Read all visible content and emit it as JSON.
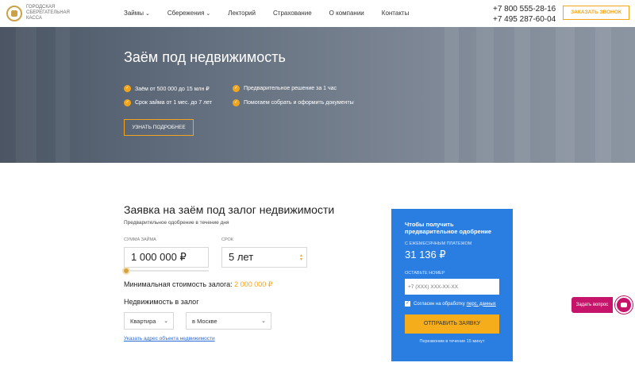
{
  "header": {
    "logo_text": "Городская сберегательная касса",
    "nav": [
      {
        "label": "Займы",
        "dropdown": true
      },
      {
        "label": "Сбережения",
        "dropdown": true
      },
      {
        "label": "Лекторий",
        "dropdown": false
      },
      {
        "label": "Страхование",
        "dropdown": false
      },
      {
        "label": "О компании",
        "dropdown": false
      },
      {
        "label": "Контакты",
        "dropdown": false
      }
    ],
    "phone1": "+7 800 555-28-16",
    "phone2": "+7 495 287-60-04",
    "call_button": "Заказать звонок"
  },
  "hero": {
    "title": "Заём под недвижимость",
    "features": [
      "Заём от 500 000 до 15 млн ₽",
      "Срок займа от 1 мес. до 7 лет",
      "Предварительное решение за 1 час",
      "Помогаем собрать и оформить документы"
    ],
    "more_button": "Узнать подробнее"
  },
  "form": {
    "title": "Заявка на заём под залог недвижимости",
    "subtitle": "Предварительное одобрение в течение дня",
    "amount_label": "Сумма займа",
    "amount_value": "1 000 000 ₽",
    "term_label": "Срок",
    "term_value": "5 лет",
    "min_cost_label": "Минимальная стоимость залога:",
    "min_cost_value": "2 000 000 ₽",
    "property_title": "Недвижимость в залог",
    "property_type": "Квартира",
    "property_location": "в Москве",
    "address_link": "Указать адрес объекта недвижимости"
  },
  "card": {
    "title": "Чтобы получить предварительное одобрение",
    "monthly_label": "С ежемесячным платежом",
    "monthly_value": "31 136 ₽",
    "phone_label": "Оставьте номер",
    "phone_placeholder": "+7 (XXX) XXX-XX-XX",
    "agree_text": "Согласен на обработку",
    "agree_link": "перс. данных",
    "agree_checked": true,
    "send_button": "Отправить заявку",
    "callback_note": "Перезвоним в течение 15 минут"
  },
  "chat": {
    "ask_label": "Задать вопрос"
  },
  "colors": {
    "accent": "#f2a51a",
    "card_blue": "#2a7de1",
    "chat_pink": "#c7146b",
    "link": "#2a6bd8"
  }
}
